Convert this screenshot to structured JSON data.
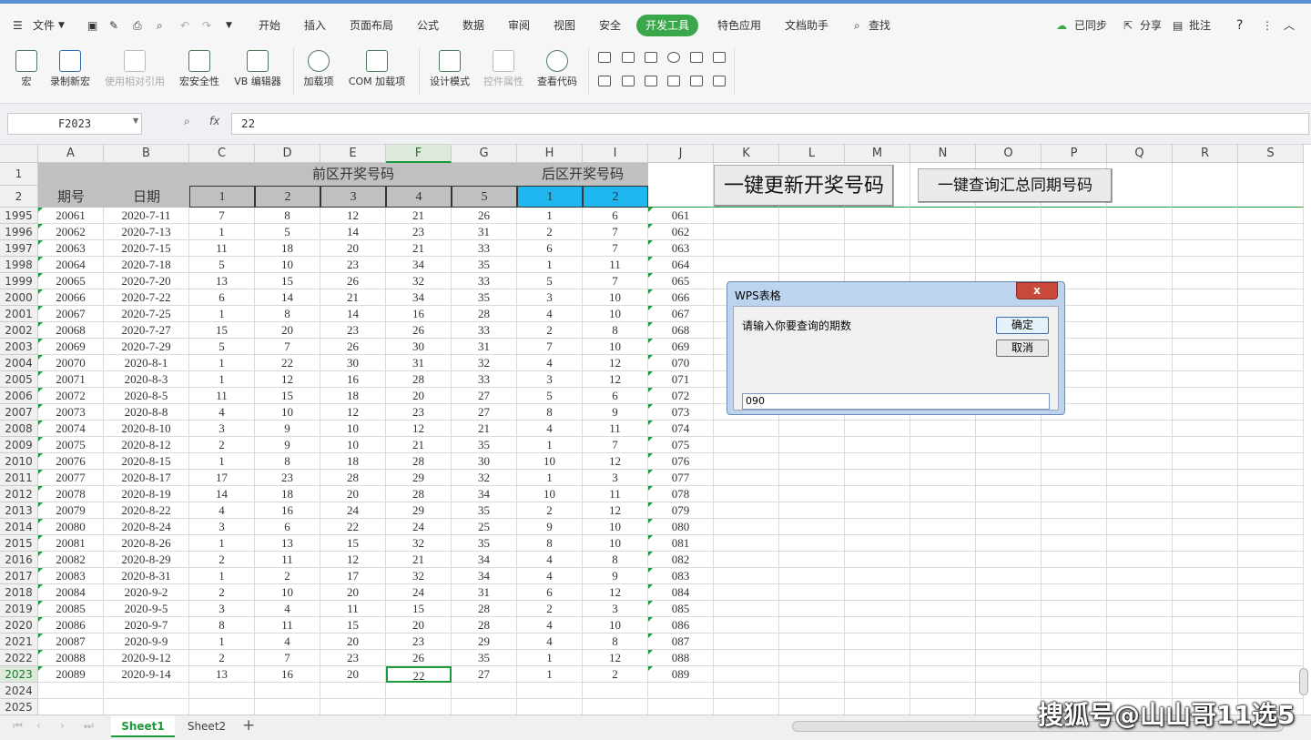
{
  "menu": {
    "file": "文件",
    "tabs": [
      "开始",
      "插入",
      "页面布局",
      "公式",
      "数据",
      "审阅",
      "视图",
      "安全",
      "开发工具",
      "特色应用",
      "文档助手",
      "查找"
    ],
    "active_tab": "开发工具",
    "sync": "已同步",
    "share": "分享",
    "comment": "批注",
    "help": "?"
  },
  "ribbon": {
    "macro": "宏",
    "record_macro": "录制新宏",
    "relative_ref": "使用相对引用",
    "macro_security": "宏安全性",
    "vb_editor": "VB 编辑器",
    "addins": "加载项",
    "com_addins": "COM 加载项",
    "design_mode": "设计模式",
    "control_props": "控件属性",
    "view_code": "查看代码"
  },
  "formula": {
    "cell_ref": "F2023",
    "fx": "fx",
    "value": "22"
  },
  "columns": [
    "A",
    "B",
    "C",
    "D",
    "E",
    "F",
    "G",
    "H",
    "I",
    "J",
    "K",
    "L",
    "M",
    "N",
    "O",
    "P",
    "Q",
    "R",
    "S"
  ],
  "header": {
    "front_title": "前区开奖号码",
    "back_title": "后区开奖号码",
    "period": "期号",
    "date": "日期",
    "front_nums": [
      "1",
      "2",
      "3",
      "4",
      "5"
    ],
    "back_nums": [
      "1",
      "2"
    ]
  },
  "buttons": {
    "update": "一键更新开奖号码",
    "query": "一键查询汇总同期号码"
  },
  "rows": [
    {
      "n": "1995",
      "p": "20061",
      "d": "2020-7-11",
      "c": [
        "7",
        "8",
        "12",
        "21",
        "26",
        "1",
        "6"
      ],
      "j": "061"
    },
    {
      "n": "1996",
      "p": "20062",
      "d": "2020-7-13",
      "c": [
        "1",
        "5",
        "14",
        "23",
        "31",
        "2",
        "7"
      ],
      "j": "062"
    },
    {
      "n": "1997",
      "p": "20063",
      "d": "2020-7-15",
      "c": [
        "11",
        "18",
        "20",
        "21",
        "33",
        "6",
        "7"
      ],
      "j": "063"
    },
    {
      "n": "1998",
      "p": "20064",
      "d": "2020-7-18",
      "c": [
        "5",
        "10",
        "23",
        "34",
        "35",
        "1",
        "11"
      ],
      "j": "064"
    },
    {
      "n": "1999",
      "p": "20065",
      "d": "2020-7-20",
      "c": [
        "13",
        "15",
        "26",
        "32",
        "33",
        "5",
        "7"
      ],
      "j": "065"
    },
    {
      "n": "2000",
      "p": "20066",
      "d": "2020-7-22",
      "c": [
        "6",
        "14",
        "21",
        "34",
        "35",
        "3",
        "10"
      ],
      "j": "066"
    },
    {
      "n": "2001",
      "p": "20067",
      "d": "2020-7-25",
      "c": [
        "1",
        "8",
        "14",
        "16",
        "28",
        "4",
        "10"
      ],
      "j": "067"
    },
    {
      "n": "2002",
      "p": "20068",
      "d": "2020-7-27",
      "c": [
        "15",
        "20",
        "23",
        "26",
        "33",
        "2",
        "8"
      ],
      "j": "068"
    },
    {
      "n": "2003",
      "p": "20069",
      "d": "2020-7-29",
      "c": [
        "5",
        "7",
        "26",
        "30",
        "31",
        "7",
        "10"
      ],
      "j": "069"
    },
    {
      "n": "2004",
      "p": "20070",
      "d": "2020-8-1",
      "c": [
        "1",
        "22",
        "30",
        "31",
        "32",
        "4",
        "12"
      ],
      "j": "070"
    },
    {
      "n": "2005",
      "p": "20071",
      "d": "2020-8-3",
      "c": [
        "1",
        "12",
        "16",
        "28",
        "33",
        "3",
        "12"
      ],
      "j": "071"
    },
    {
      "n": "2006",
      "p": "20072",
      "d": "2020-8-5",
      "c": [
        "11",
        "15",
        "18",
        "20",
        "27",
        "5",
        "6"
      ],
      "j": "072"
    },
    {
      "n": "2007",
      "p": "20073",
      "d": "2020-8-8",
      "c": [
        "4",
        "10",
        "12",
        "23",
        "27",
        "8",
        "9"
      ],
      "j": "073"
    },
    {
      "n": "2008",
      "p": "20074",
      "d": "2020-8-10",
      "c": [
        "3",
        "9",
        "10",
        "12",
        "21",
        "4",
        "11"
      ],
      "j": "074"
    },
    {
      "n": "2009",
      "p": "20075",
      "d": "2020-8-12",
      "c": [
        "2",
        "9",
        "10",
        "21",
        "35",
        "1",
        "7"
      ],
      "j": "075"
    },
    {
      "n": "2010",
      "p": "20076",
      "d": "2020-8-15",
      "c": [
        "1",
        "8",
        "18",
        "28",
        "30",
        "10",
        "12"
      ],
      "j": "076"
    },
    {
      "n": "2011",
      "p": "20077",
      "d": "2020-8-17",
      "c": [
        "17",
        "23",
        "28",
        "29",
        "32",
        "1",
        "3"
      ],
      "j": "077"
    },
    {
      "n": "2012",
      "p": "20078",
      "d": "2020-8-19",
      "c": [
        "14",
        "18",
        "20",
        "28",
        "34",
        "10",
        "11"
      ],
      "j": "078"
    },
    {
      "n": "2013",
      "p": "20079",
      "d": "2020-8-22",
      "c": [
        "4",
        "16",
        "24",
        "29",
        "35",
        "2",
        "12"
      ],
      "j": "079"
    },
    {
      "n": "2014",
      "p": "20080",
      "d": "2020-8-24",
      "c": [
        "3",
        "6",
        "22",
        "24",
        "25",
        "9",
        "10"
      ],
      "j": "080"
    },
    {
      "n": "2015",
      "p": "20081",
      "d": "2020-8-26",
      "c": [
        "1",
        "13",
        "15",
        "32",
        "35",
        "8",
        "10"
      ],
      "j": "081"
    },
    {
      "n": "2016",
      "p": "20082",
      "d": "2020-8-29",
      "c": [
        "2",
        "11",
        "12",
        "21",
        "34",
        "4",
        "8"
      ],
      "j": "082"
    },
    {
      "n": "2017",
      "p": "20083",
      "d": "2020-8-31",
      "c": [
        "1",
        "2",
        "17",
        "32",
        "34",
        "4",
        "9"
      ],
      "j": "083"
    },
    {
      "n": "2018",
      "p": "20084",
      "d": "2020-9-2",
      "c": [
        "2",
        "10",
        "20",
        "24",
        "31",
        "6",
        "12"
      ],
      "j": "084"
    },
    {
      "n": "2019",
      "p": "20085",
      "d": "2020-9-5",
      "c": [
        "3",
        "4",
        "11",
        "15",
        "28",
        "2",
        "3"
      ],
      "j": "085"
    },
    {
      "n": "2020",
      "p": "20086",
      "d": "2020-9-7",
      "c": [
        "8",
        "11",
        "15",
        "20",
        "28",
        "4",
        "10"
      ],
      "j": "086"
    },
    {
      "n": "2021",
      "p": "20087",
      "d": "2020-9-9",
      "c": [
        "1",
        "4",
        "20",
        "23",
        "29",
        "4",
        "8"
      ],
      "j": "087"
    },
    {
      "n": "2022",
      "p": "20088",
      "d": "2020-9-12",
      "c": [
        "2",
        "7",
        "23",
        "26",
        "35",
        "1",
        "12"
      ],
      "j": "088"
    },
    {
      "n": "2023",
      "p": "20089",
      "d": "2020-9-14",
      "c": [
        "13",
        "16",
        "20",
        "22",
        "27",
        "1",
        "2"
      ],
      "j": "089"
    }
  ],
  "extra_rows": [
    "2024",
    "2025"
  ],
  "dialog": {
    "title": "WPS表格",
    "prompt": "请输入你要查询的期数",
    "ok": "确定",
    "cancel": "取消",
    "input": "090",
    "close": "x"
  },
  "sheets": [
    "Sheet1",
    "Sheet2"
  ],
  "active_sheet": "Sheet1",
  "watermark": "搜狐号@山山哥11选5",
  "colors": {
    "accent": "#3aa84a",
    "header_gray": "#c0c0c0",
    "back_blue": "#1fb6f0",
    "select_green": "#1a9a3a"
  }
}
